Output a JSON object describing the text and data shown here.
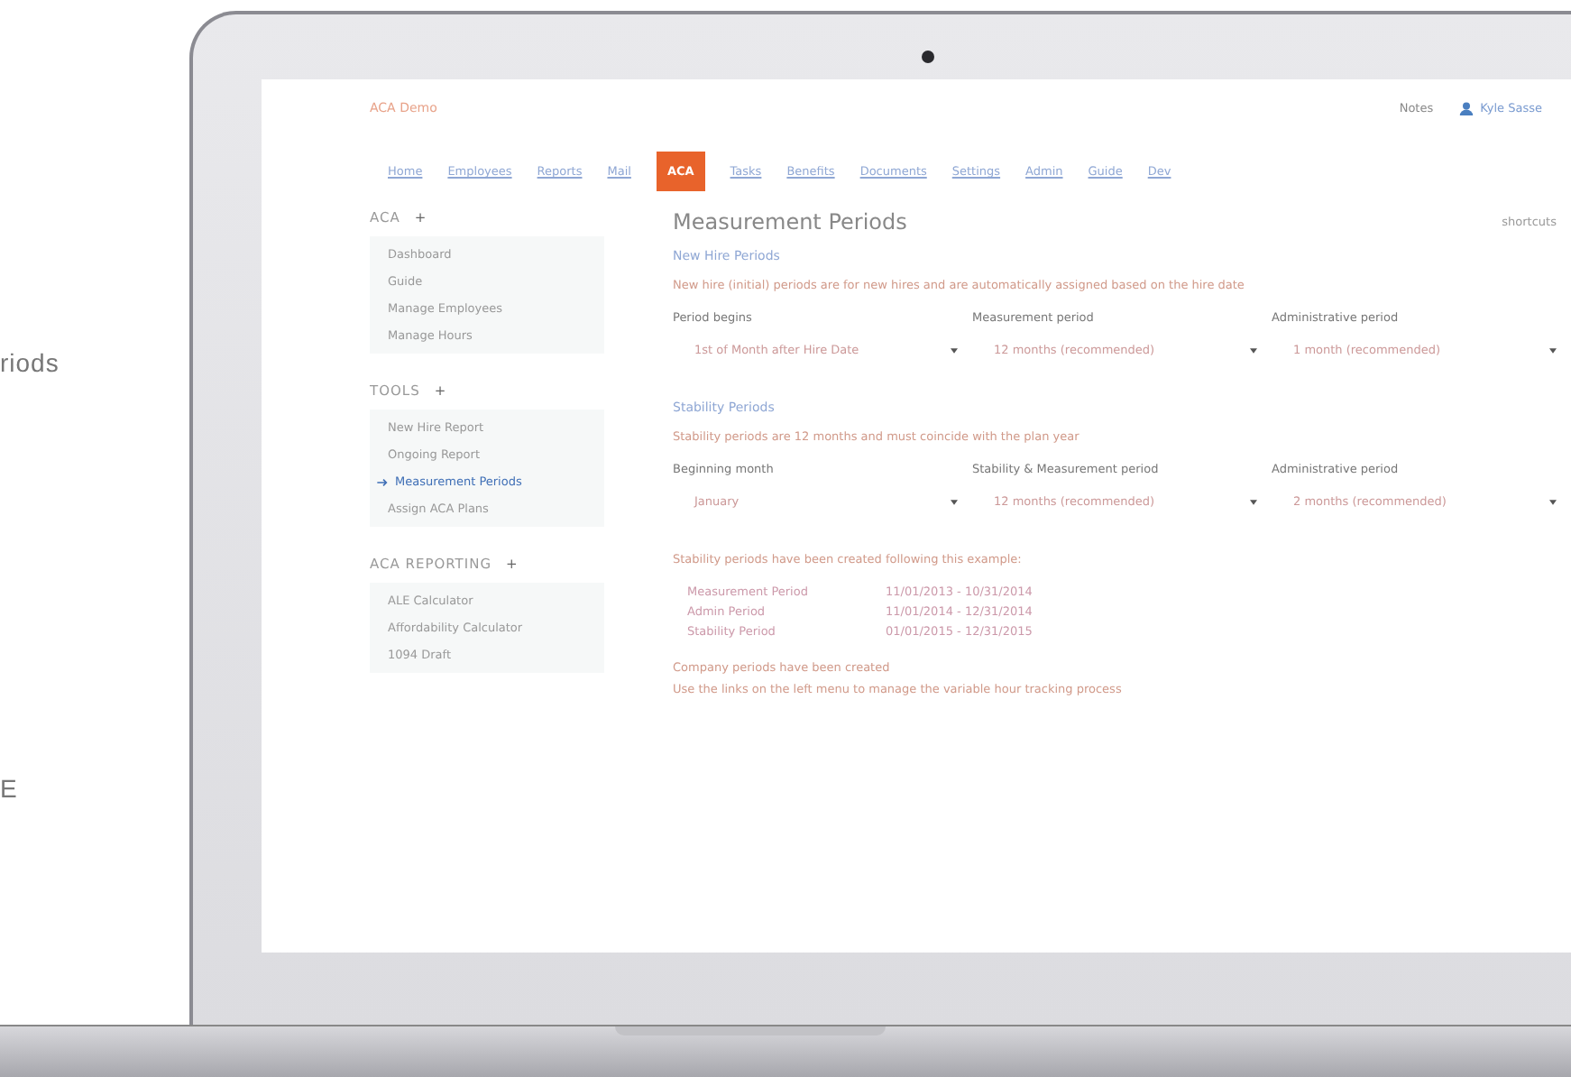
{
  "backdrop_texts": [
    "riods",
    "E"
  ],
  "header": {
    "app_title": "ACA Demo",
    "notes": "Notes",
    "user": "Kyle Sasse"
  },
  "nav": [
    {
      "label": "Home",
      "selected": false
    },
    {
      "label": "Employees",
      "selected": false
    },
    {
      "label": "Reports",
      "selected": false
    },
    {
      "label": "Mail",
      "selected": false
    },
    {
      "label": "ACA",
      "selected": true
    },
    {
      "label": "Tasks",
      "selected": false
    },
    {
      "label": "Benefits",
      "selected": false
    },
    {
      "label": "Documents",
      "selected": false
    },
    {
      "label": "Settings",
      "selected": false
    },
    {
      "label": "Admin",
      "selected": false
    },
    {
      "label": "Guide",
      "selected": false
    },
    {
      "label": "Dev",
      "selected": false
    }
  ],
  "sidebar": [
    {
      "title": "ACA",
      "toggle": "+",
      "items": [
        {
          "label": "Dashboard",
          "selected": false
        },
        {
          "label": "Guide",
          "selected": false
        },
        {
          "label": "Manage Employees",
          "selected": false
        },
        {
          "label": "Manage Hours",
          "selected": false
        }
      ]
    },
    {
      "title": "TOOLS",
      "toggle": "+",
      "items": [
        {
          "label": "New Hire Report",
          "selected": false
        },
        {
          "label": "Ongoing Report",
          "selected": false
        },
        {
          "label": "Measurement Periods",
          "selected": true
        },
        {
          "label": "Assign ACA Plans",
          "selected": false
        }
      ]
    },
    {
      "title": "ACA REPORTING",
      "toggle": "+",
      "items": [
        {
          "label": "ALE Calculator",
          "selected": false
        },
        {
          "label": "Affordability Calculator",
          "selected": false
        },
        {
          "label": "1094 Draft",
          "selected": false
        }
      ]
    }
  ],
  "main": {
    "title": "Measurement Periods",
    "shortcuts": "shortcuts",
    "sections": [
      {
        "heading": "New Hire Periods",
        "description": "New hire (initial) periods are for new hires and are automatically assigned based on the hire date",
        "fields": [
          {
            "label": "Period begins",
            "value": "1st of Month after Hire Date"
          },
          {
            "label": "Measurement period",
            "value": "12 months (recommended)"
          },
          {
            "label": "Administrative period",
            "value": "1 month (recommended)"
          }
        ]
      },
      {
        "heading": "Stability Periods",
        "description": "Stability periods are 12 months and must coincide with the plan year",
        "fields": [
          {
            "label": "Beginning month",
            "value": "January"
          },
          {
            "label": "Stability & Measurement period",
            "value": "12 months (recommended)"
          },
          {
            "label": "Administrative period",
            "value": "2 months (recommended)"
          }
        ]
      }
    ],
    "example_intro": "Stability periods have been created following this example:",
    "example": [
      {
        "name": "Measurement Period",
        "range": "11/01/2013 - 10/31/2014"
      },
      {
        "name": "Admin Period",
        "range": "11/01/2014 - 12/31/2014"
      },
      {
        "name": "Stability Period",
        "range": "01/01/2015 - 12/31/2015"
      }
    ],
    "notes": [
      "Company periods have been created",
      "Use the links on the left menu to manage the variable hour tracking process"
    ]
  }
}
